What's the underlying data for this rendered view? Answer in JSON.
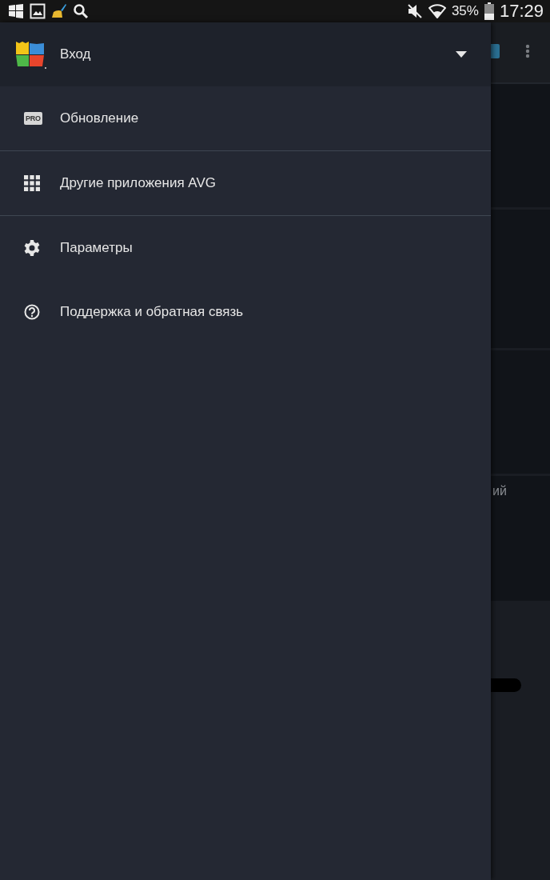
{
  "status_bar": {
    "battery_percent": "35%",
    "time": "17:29"
  },
  "drawer": {
    "header": {
      "label": "Вход",
      "expanded": false
    },
    "items": [
      {
        "kind": "pro",
        "badge": "PRO",
        "label": "Обновление",
        "divider_after": true
      },
      {
        "kind": "apps",
        "label": "Другие приложения AVG",
        "divider_after": true
      },
      {
        "kind": "settings",
        "label": "Параметры",
        "divider_after": false
      },
      {
        "kind": "help",
        "label": "Поддержка и обратная связь",
        "divider_after": false
      }
    ]
  },
  "background_screen": {
    "card_text": "ий"
  }
}
